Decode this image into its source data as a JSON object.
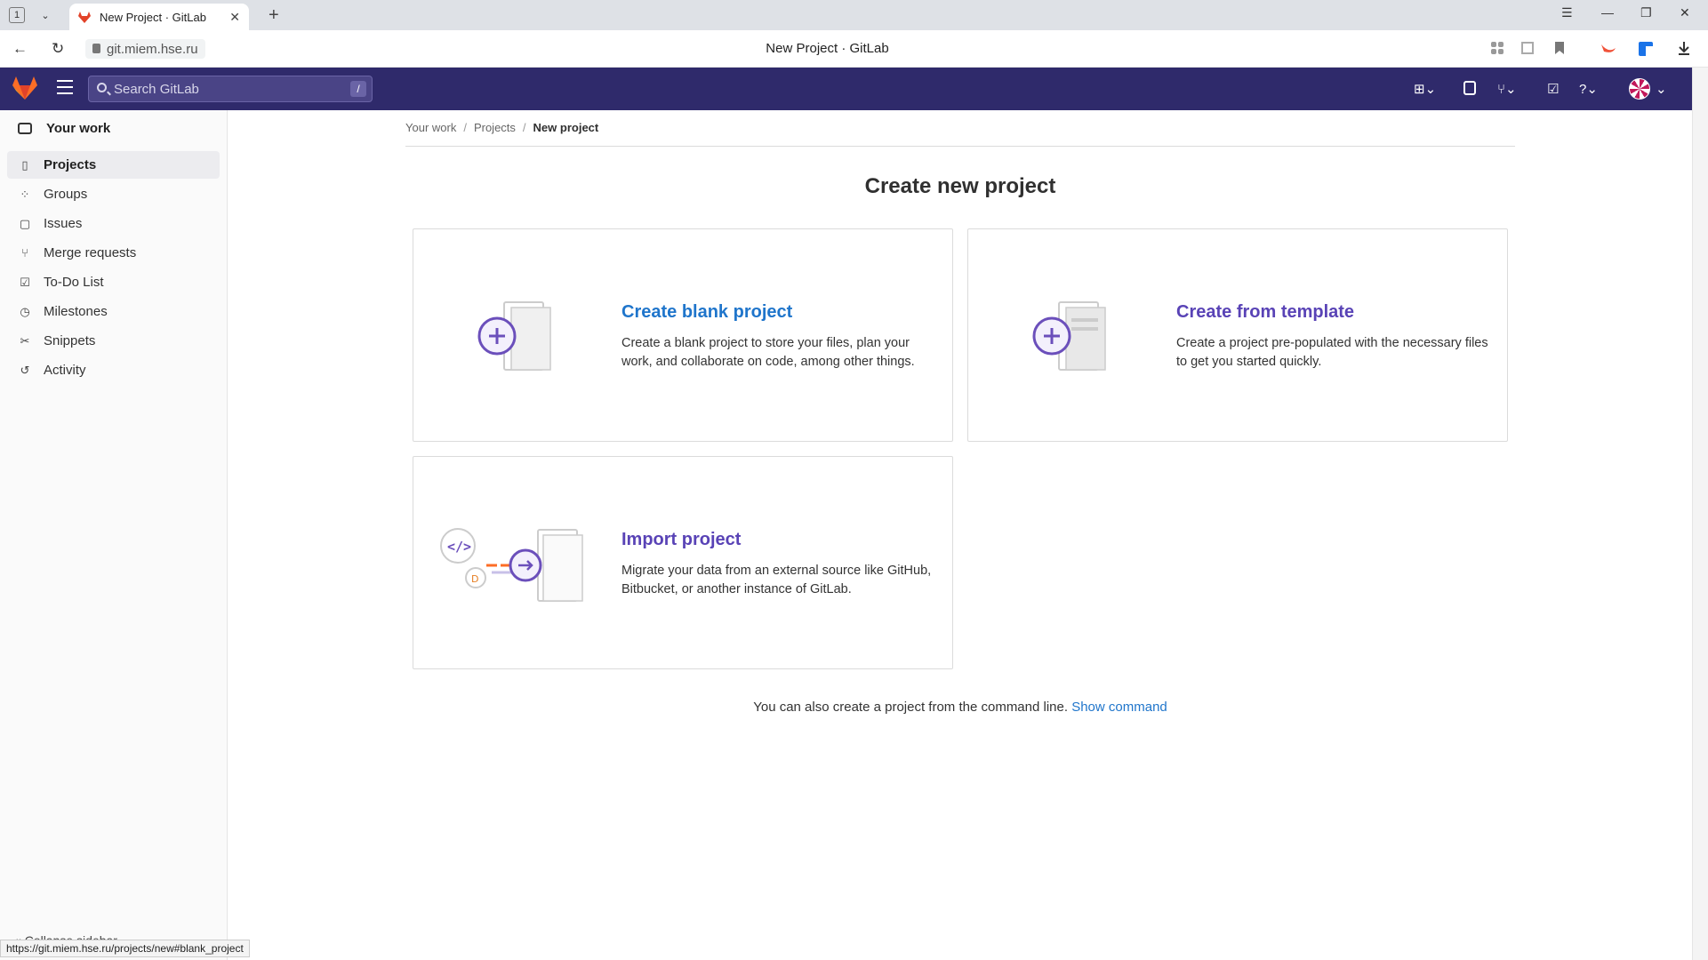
{
  "browser": {
    "tab_count": "1",
    "tab_title": "New Project · GitLab",
    "url": "git.miem.hse.ru",
    "page_title": "New Project · GitLab",
    "status_url": "https://git.miem.hse.ru/projects/new#blank_project"
  },
  "topnav": {
    "search_placeholder": "Search GitLab",
    "search_shortcut": "/"
  },
  "sidebar": {
    "header": "Your work",
    "items": [
      {
        "label": "Projects",
        "icon": "project-icon",
        "active": true
      },
      {
        "label": "Groups",
        "icon": "group-icon",
        "active": false
      },
      {
        "label": "Issues",
        "icon": "issues-icon",
        "active": false
      },
      {
        "label": "Merge requests",
        "icon": "merge-request-icon",
        "active": false
      },
      {
        "label": "To-Do List",
        "icon": "todo-icon",
        "active": false
      },
      {
        "label": "Milestones",
        "icon": "milestone-icon",
        "active": false
      },
      {
        "label": "Snippets",
        "icon": "snippet-icon",
        "active": false
      },
      {
        "label": "Activity",
        "icon": "history-icon",
        "active": false
      }
    ],
    "collapse_label": "Collapse sidebar"
  },
  "breadcrumb": [
    "Your work",
    "Projects",
    "New project"
  ],
  "main": {
    "heading": "Create new project",
    "cards": [
      {
        "title": "Create blank project",
        "description": "Create a blank project to store your files, plan your work, and collaborate on code, among other things."
      },
      {
        "title": "Create from template",
        "description": "Create a project pre-populated with the necessary files to get you started quickly."
      },
      {
        "title": "Import project",
        "description": "Migrate your data from an external source like GitHub, Bitbucket, or another instance of GitLab."
      }
    ],
    "cmdline_text": "You can also create a project from the command line.",
    "cmdline_link": "Show command"
  },
  "colors": {
    "topnav": "#2f2a6b",
    "accent_purple": "#5943b6",
    "link_blue": "#1f75cb",
    "gitlab_orange": "#fc6d26"
  }
}
